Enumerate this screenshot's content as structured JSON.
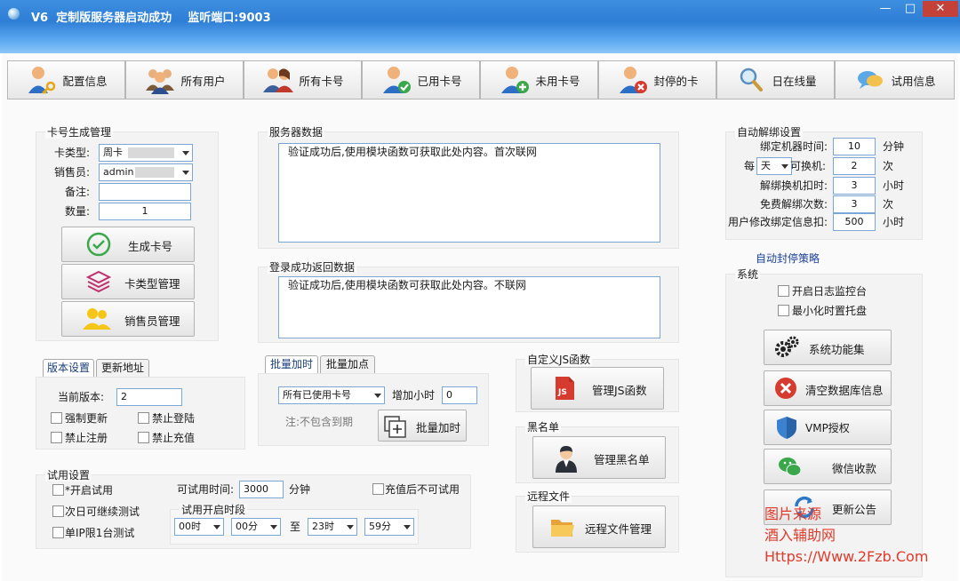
{
  "window": {
    "title": "V6  定制版服务器启动成功    监听端口:9003",
    "min": "—",
    "max": "□",
    "close": "✕"
  },
  "toolbar": [
    {
      "label": "配置信息",
      "icon": "user-key-icon"
    },
    {
      "label": "所有用户",
      "icon": "users-group-icon"
    },
    {
      "label": "所有卡号",
      "icon": "couple-users-icon"
    },
    {
      "label": "已用卡号",
      "icon": "user-check-icon"
    },
    {
      "label": "未用卡号",
      "icon": "user-add-icon"
    },
    {
      "label": "封停的卡",
      "icon": "user-block-icon"
    },
    {
      "label": "日在线量",
      "icon": "magnifier-icon"
    },
    {
      "label": "试用信息",
      "icon": "chat-bubbles-icon"
    }
  ],
  "card_gen": {
    "title": "卡号生成管理",
    "type_label": "卡类型:",
    "type_value": "周卡",
    "seller_label": "销售员:",
    "seller_value": "admin",
    "note_label": "备注:",
    "note_value": "",
    "qty_label": "数量:",
    "qty_value": "1",
    "btn_generate": "生成卡号",
    "btn_type_mgmt": "卡类型管理",
    "btn_seller_mgmt": "销售员管理"
  },
  "server_data": {
    "title": "服务器数据",
    "text": "验证成功后,使用模块函数可获取此处内容。首次联网"
  },
  "login_return": {
    "title": "登录成功返回数据",
    "text": "验证成功后,使用模块函数可获取此处内容。不联网"
  },
  "auto_unbind": {
    "title": "自动解绑设置",
    "bind_time_label": "绑定机器时间:",
    "bind_time_value": "10",
    "bind_time_unit": "分钟",
    "per_label": "每",
    "per_value": "天",
    "changeable_label": "可换机:",
    "changeable_value": "2",
    "changeable_unit": "次",
    "deduct_label": "解绑换机扣时:",
    "deduct_value": "3",
    "deduct_unit": "小时",
    "free_label": "免费解绑次数:",
    "free_value": "3",
    "free_unit": "次",
    "modify_label": "用户修改绑定信息扣:",
    "modify_value": "500",
    "modify_unit": "小时"
  },
  "auto_ban_link": "自动封停策略",
  "system": {
    "title": "系统",
    "log_monitor": "开启日志监控台",
    "minimize_tray": "最小化时置托盘",
    "btn_features": "系统功能集",
    "btn_clear_db": "清空数据库信息",
    "btn_vmp": "VMP授权",
    "btn_wechat": "微信收款",
    "btn_notice": "更新公告"
  },
  "version": {
    "tab_settings": "版本设置",
    "tab_update": "更新地址",
    "current_label": "当前版本:",
    "current_value": "2",
    "force_update": "强制更新",
    "forbid_login": "禁止登陆",
    "forbid_register": "禁止注册",
    "forbid_recharge": "禁止充值"
  },
  "batch": {
    "tab_time": "批量加时",
    "tab_points": "批量加点",
    "target_value": "所有已使用卡号",
    "add_hours_label": "增加小时",
    "add_hours_value": "0",
    "note": "注:不包含到期",
    "btn_add": "批量加时"
  },
  "custom_js": {
    "title": "自定义JS函数",
    "btn": "管理JS函数"
  },
  "blacklist": {
    "title": "黑名单",
    "btn": "管理黑名单"
  },
  "remote_files": {
    "title": "远程文件",
    "btn": "远程文件管理"
  },
  "trial": {
    "title": "试用设置",
    "enable": "*开启试用",
    "next_day": "次日可继续测试",
    "single_ip": "单IP限1台测试",
    "time_label": "可试用时间:",
    "time_value": "3000",
    "time_unit": "分钟",
    "no_trial_after_recharge": "充值后不可试用",
    "period_title": "试用开启时段",
    "from_hour": "00时",
    "from_min": "00分",
    "to_label": "至",
    "to_hour": "23时",
    "to_min": "59分"
  },
  "watermark": {
    "line1": "图片来源",
    "line2": "酒入辅助网",
    "line3": "Https://Www.2Fzb.Com"
  },
  "colors": {
    "title_bar": "#2e7ed6",
    "accent_link": "#1b3f9c",
    "watermark": "#e03a2b"
  }
}
